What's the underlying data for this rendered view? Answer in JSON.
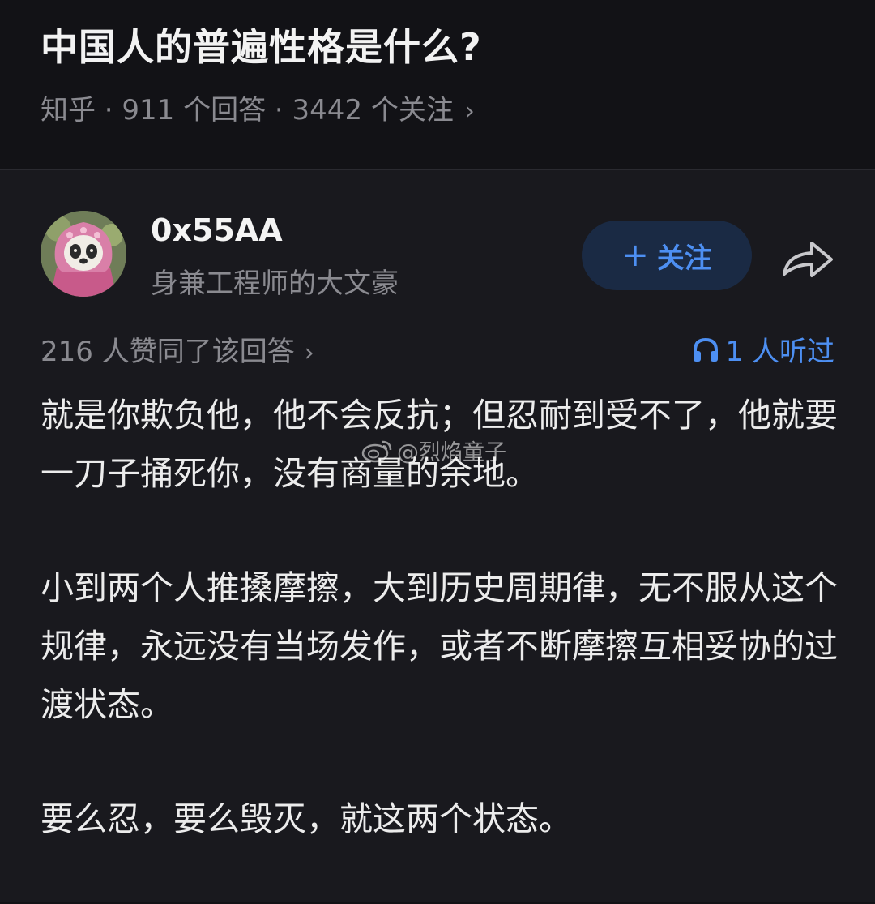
{
  "question": {
    "title": "中国人的普遍性格是什么?",
    "meta": "知乎 · 911 个回答 · 3442 个关注",
    "chevron": "›"
  },
  "author": {
    "name": "0x55AA",
    "bio": "身兼工程师的大文豪",
    "follow_label": "关注",
    "follow_plus": "+",
    "avatar_icon": "panda-avatar"
  },
  "stats": {
    "votes": "216 人赞同了该回答",
    "votes_chevron": "›",
    "listens": "1 人听过",
    "listens_icon": "headphones-icon"
  },
  "answer": {
    "paragraphs": [
      "就是你欺负他，他不会反抗；但忍耐到受不了，他就要一刀子捅死你，没有商量的余地。",
      "小到两个人推搡摩擦，大到历史周期律，无不服从这个规律，永远没有当场发作，或者不断摩擦互相妥协的过渡状态。",
      "要么忍，要么毁灭，就这两个状态。"
    ]
  },
  "watermark": {
    "text": "@烈焰童子",
    "icon": "weibo-icon"
  },
  "colors": {
    "accent": "#4d8ff2",
    "background": "#19191e",
    "header_background": "#121216",
    "muted_text": "#8a8a90"
  }
}
